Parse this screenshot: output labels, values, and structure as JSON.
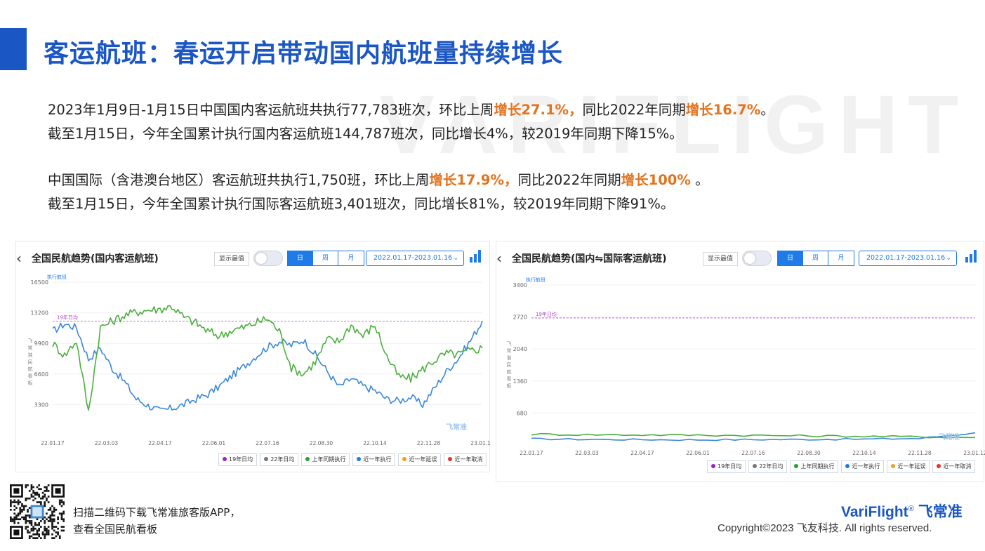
{
  "page": {
    "title": "客运航班：春运开启带动国内航班量持续增长",
    "watermark": "VARIFLIGHT",
    "block1": {
      "line1": [
        {
          "t": "2023年1月9日-1月15日中国国内客运航班共执行77,783班次，环比上周",
          "hl": false
        },
        {
          "t": "增长27.1%，",
          "hl": true
        },
        {
          "t": "同比2022年同期",
          "hl": false
        },
        {
          "t": "增长16.7%",
          "hl": true
        },
        {
          "t": "。",
          "hl": false
        }
      ],
      "line2": "截至1月15日，今年全国累计执行国内客运航班144,787班次，同比增长4%，较2019年同期下降15%。"
    },
    "block2": {
      "line1": [
        {
          "t": "中国国际（含港澳台地区）客运航班共执行1,750班，环比上周",
          "hl": false
        },
        {
          "t": "增长17.9%，",
          "hl": true
        },
        {
          "t": "同比2022年同期",
          "hl": false
        },
        {
          "t": "增长100%",
          "hl": true
        },
        {
          "t": " 。",
          "hl": false
        }
      ],
      "line2": "截至1月15日，今年全国累计执行国际客运航班3,401班次，同比增长81%，较2019年同期下降91%。"
    },
    "footer": {
      "qr_line1": "扫描二维码下载飞常准旅客版APP，",
      "qr_line2": "查看全国民航看板",
      "logo_en": "VariFlight",
      "logo_reg": "®",
      "logo_cn": "飞常准",
      "copyright": "Copyright©2023 飞友科技. All rights reserved."
    }
  },
  "ui": {
    "back_icon": "‹",
    "show_max_label": "显示最值",
    "segments": [
      "日",
      "周",
      "月"
    ],
    "active_segment": "日",
    "date_range": "2022.01.17-2023.01.16",
    "dropdown_icon": "⌄",
    "unit_label": "执行航班",
    "side_label": "飞常准民航看板",
    "ref_line_label": "19年日均",
    "brand_mark": "飞常准",
    "legend": [
      {
        "label": "19年日均",
        "color": "#a020c8"
      },
      {
        "label": "22年日均",
        "color": "#777777"
      },
      {
        "label": "上年同期执行",
        "color": "#2aa02a"
      },
      {
        "label": "近一年执行",
        "color": "#1f7be8"
      },
      {
        "label": "近一年延误",
        "color": "#f0a020"
      },
      {
        "label": "近一年取消",
        "color": "#e83030"
      }
    ],
    "colors": {
      "accent": "#1a56c4",
      "highlight": "#e2731f",
      "series_blue": "#3a88d8",
      "series_green": "#4aaf3c",
      "ref_line": "#b04ad0"
    }
  },
  "chart_data": [
    {
      "type": "line",
      "title": "全国民航趋势(国内客运航班)",
      "ylabel": "执行航班",
      "ylim": [
        0,
        16500
      ],
      "yticks": [
        3300,
        6600,
        9900,
        13200,
        16500
      ],
      "xticks": [
        "22.01.17",
        "22.03.03",
        "22.04.17",
        "22.06.01",
        "22.07.16",
        "22.08.30",
        "22.10.14",
        "22.11.28",
        "23.01.12"
      ],
      "reference_line": {
        "name": "19年日均",
        "value": 12300
      },
      "series": [
        {
          "name": "近一年执行",
          "color": "#3a88d8",
          "x": [
            "22.01.17",
            "22.01.27",
            "22.02.06",
            "22.02.16",
            "22.02.26",
            "22.03.08",
            "22.03.18",
            "22.03.28",
            "22.04.07",
            "22.04.17",
            "22.04.27",
            "22.05.07",
            "22.05.17",
            "22.05.27",
            "22.06.06",
            "22.06.16",
            "22.06.26",
            "22.07.06",
            "22.07.16",
            "22.07.26",
            "22.08.05",
            "22.08.15",
            "22.08.25",
            "22.09.04",
            "22.09.14",
            "22.09.24",
            "22.10.04",
            "22.10.14",
            "22.10.24",
            "22.11.03",
            "22.11.13",
            "22.11.23",
            "22.12.03",
            "22.12.13",
            "22.12.23",
            "23.01.02",
            "23.01.12"
          ],
          "values": [
            11200,
            12000,
            11600,
            8200,
            9400,
            7200,
            5800,
            3900,
            3200,
            2600,
            2900,
            3300,
            3900,
            4400,
            5300,
            6400,
            7400,
            8500,
            9500,
            10100,
            9700,
            10300,
            8700,
            6900,
            5200,
            6100,
            5300,
            4800,
            3900,
            3700,
            4100,
            3300,
            5100,
            6900,
            8300,
            10200,
            12300
          ]
        },
        {
          "name": "上年同期执行",
          "color": "#4aaf3c",
          "x": [
            "22.01.17",
            "22.01.27",
            "22.02.06",
            "22.02.16",
            "22.02.26",
            "22.03.08",
            "22.03.18",
            "22.03.28",
            "22.04.07",
            "22.04.17",
            "22.04.27",
            "22.05.07",
            "22.05.17",
            "22.05.27",
            "22.06.06",
            "22.06.16",
            "22.06.26",
            "22.07.06",
            "22.07.16",
            "22.07.26",
            "22.08.05",
            "22.08.15",
            "22.08.25",
            "22.09.04",
            "22.09.14",
            "22.09.24",
            "22.10.04",
            "22.10.14",
            "22.10.24",
            "22.11.03",
            "22.11.13",
            "22.11.23",
            "22.12.03",
            "22.12.13",
            "22.12.23",
            "23.01.02",
            "23.01.12"
          ],
          "values": [
            9900,
            8600,
            10200,
            2500,
            11600,
            12300,
            12900,
            13300,
            13500,
            13600,
            13900,
            12700,
            12100,
            11200,
            10700,
            11300,
            11600,
            12100,
            12600,
            11200,
            7300,
            6600,
            7900,
            10300,
            10100,
            11900,
            10700,
            11900,
            8500,
            6300,
            6100,
            7100,
            8100,
            8800,
            8700,
            9100,
            9400
          ]
        }
      ]
    },
    {
      "type": "line",
      "title": "全国民航趋势(国内⇋国际客运航班)",
      "ylabel": "执行航班",
      "ylim": [
        0,
        3400
      ],
      "yticks": [
        680,
        1360,
        2040,
        2720,
        3400
      ],
      "xticks": [
        "22.01.17",
        "22.03.03",
        "22.04.17",
        "22.06.01",
        "22.07.16",
        "22.08.30",
        "22.10.14",
        "22.11.28",
        "23.01.12"
      ],
      "reference_line": {
        "name": "19年日均",
        "value": 2700
      },
      "series": [
        {
          "name": "近一年执行",
          "color": "#3a88d8",
          "x": [
            "22.01.17",
            "22.03.03",
            "22.04.17",
            "22.06.01",
            "22.07.16",
            "22.08.30",
            "22.10.14",
            "22.11.28",
            "23.01.12"
          ],
          "values": [
            130,
            120,
            115,
            110,
            115,
            120,
            125,
            140,
            260
          ]
        },
        {
          "name": "上年同期执行",
          "color": "#4aaf3c",
          "x": [
            "22.01.17",
            "22.03.03",
            "22.04.17",
            "22.06.01",
            "22.07.16",
            "22.08.30",
            "22.10.14",
            "22.11.28",
            "23.01.12"
          ],
          "values": [
            230,
            220,
            215,
            210,
            205,
            195,
            185,
            175,
            160
          ]
        }
      ]
    }
  ]
}
